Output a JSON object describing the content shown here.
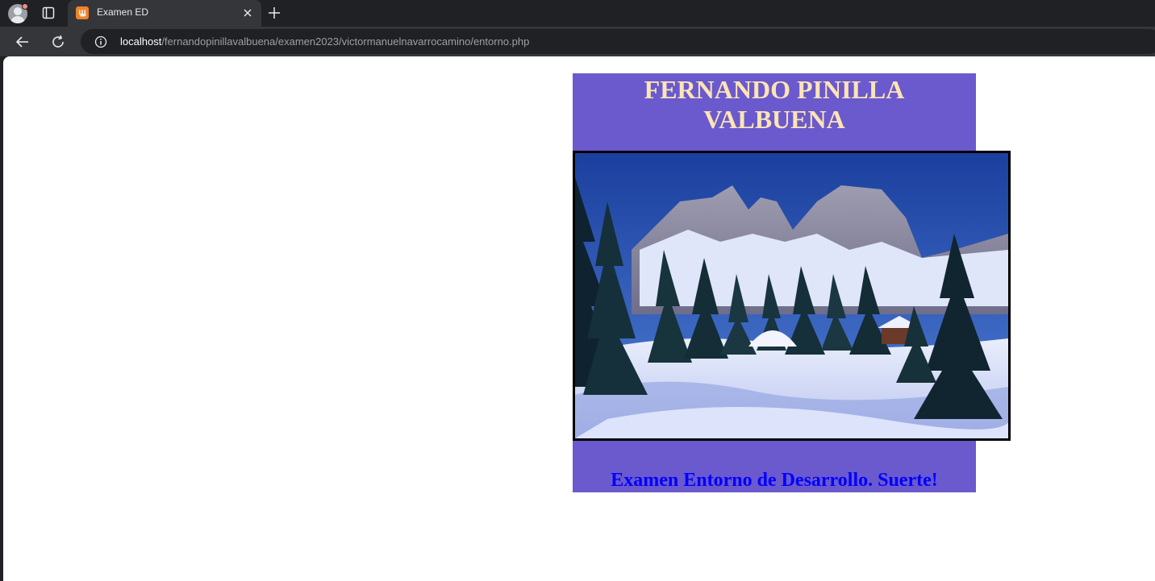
{
  "browser": {
    "tab_title": "Examen ED",
    "favicon_text": "ꚗ",
    "url_host": "localhost",
    "url_path": "/fernandopinillavalbuena/examen2023/victormanuelnavarrocamino/entorno.php"
  },
  "page": {
    "title_line1": "FERNANDO PINILLA",
    "title_line2": "VALBUENA",
    "subtitle": "Examen Entorno de Desarrollo. Suerte!",
    "image_description_icon": "snowy-mountain-landscape-image",
    "colors": {
      "card_background": "#6a5acd",
      "title_color": "#ffe4b5",
      "subtitle_color": "#0000ff"
    }
  }
}
